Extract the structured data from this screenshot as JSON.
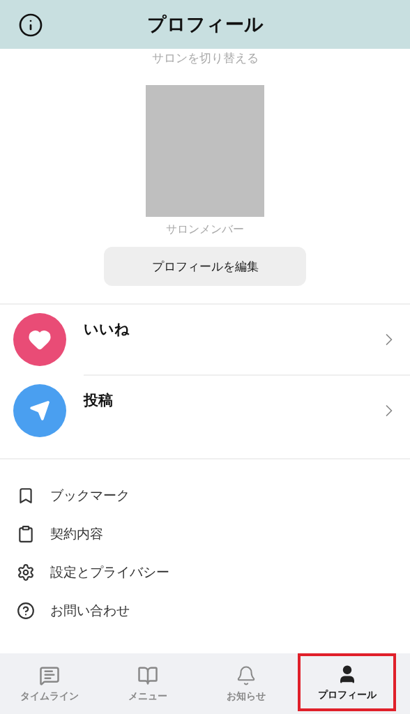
{
  "header": {
    "title": "プロフィール"
  },
  "salon_switch": "サロンを切り替える",
  "member_label": "サロンメンバー",
  "edit_button": "プロフィールを編集",
  "activity_rows": [
    {
      "kind": "like",
      "label": "いいね",
      "color": "#e94c76"
    },
    {
      "kind": "post",
      "label": "投稿",
      "color": "#4a9ff0"
    }
  ],
  "menu_items": [
    {
      "kind": "bookmark",
      "label": "ブックマーク"
    },
    {
      "kind": "contract",
      "label": "契約内容"
    },
    {
      "kind": "settings",
      "label": "設定とプライバシー"
    },
    {
      "kind": "help",
      "label": "お問い合わせ"
    }
  ],
  "tabs": [
    {
      "kind": "timeline",
      "label": "タイムライン",
      "selected": false
    },
    {
      "kind": "menu",
      "label": "メニュー",
      "selected": false
    },
    {
      "kind": "notifications",
      "label": "お知らせ",
      "selected": false
    },
    {
      "kind": "profile",
      "label": "プロフィール",
      "selected": true
    }
  ]
}
